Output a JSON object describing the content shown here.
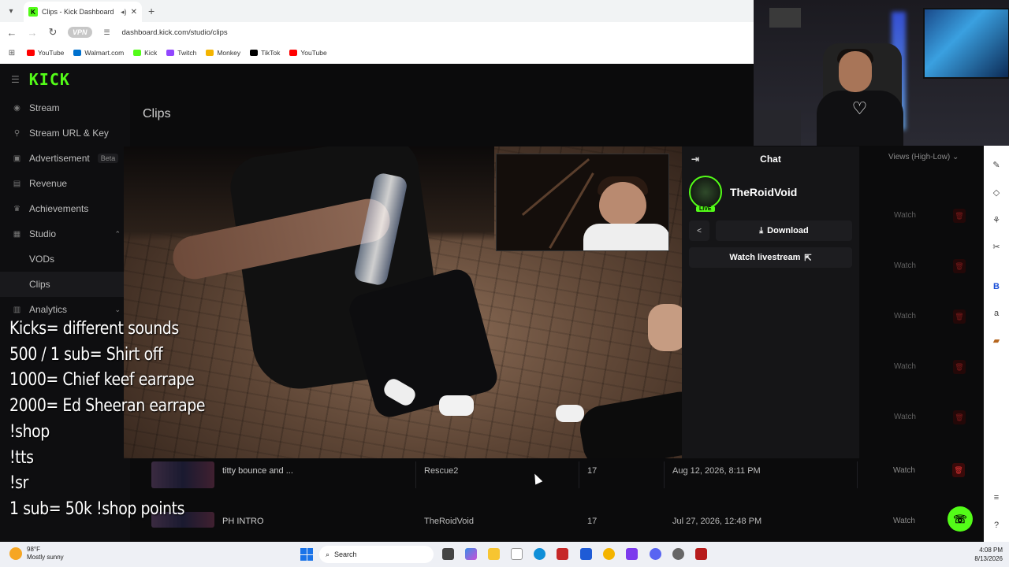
{
  "browser": {
    "tab_title": "Clips - Kick Dashboard",
    "url": "dashboard.kick.com/studio/clips",
    "vpn_label": "VPN",
    "bookmarks": [
      {
        "label": "YouTube",
        "color": "#ff0000"
      },
      {
        "label": "Walmart.com",
        "color": "#0071ce"
      },
      {
        "label": "Kick",
        "color": "#53fc18"
      },
      {
        "label": "Twitch",
        "color": "#9146ff"
      },
      {
        "label": "Monkey",
        "color": "#f4b400"
      },
      {
        "label": "TikTok",
        "color": "#000000"
      },
      {
        "label": "YouTube",
        "color": "#ff0000"
      }
    ]
  },
  "sidebar": {
    "logo": "KICK",
    "items": [
      {
        "label": "Stream",
        "icon": "broadcast-icon"
      },
      {
        "label": "Stream URL & Key",
        "icon": "link-icon"
      },
      {
        "label": "Advertisement",
        "badge": "Beta",
        "icon": "ad-icon"
      },
      {
        "label": "Revenue",
        "icon": "dollar-icon"
      },
      {
        "label": "Achievements",
        "icon": "trophy-icon"
      },
      {
        "label": "Studio",
        "icon": "grid-icon"
      },
      {
        "label": "VODs",
        "icon": ""
      },
      {
        "label": "Clips",
        "icon": ""
      },
      {
        "label": "Analytics",
        "icon": "chart-icon"
      }
    ]
  },
  "main": {
    "title": "Clips",
    "sort_filter": "Views (High-Low)",
    "watch_label": "Watch",
    "rows": [
      {
        "title": "titty bounce and ...",
        "channel": "Rescue2",
        "views": "17",
        "date": "Aug 12, 2026, 8:11 PM"
      },
      {
        "title": "PH INTRO",
        "channel": "TheRoidVoid",
        "views": "17",
        "date": "Jul 27, 2026, 12:48 PM"
      }
    ]
  },
  "chat": {
    "header": "Chat",
    "streamer": "TheRoidVoid",
    "live_badge": "LIVE",
    "download_label": "Download",
    "livestream_label": "Watch livestream"
  },
  "overlay": {
    "lines": [
      "Kicks= different sounds",
      "500 / 1 sub= Shirt off",
      "1000= Chief keef earrape",
      "2000= Ed Sheeran earrape",
      "!shop",
      "!tts",
      "!sr",
      "1 sub= 50k !shop points"
    ]
  },
  "taskbar": {
    "temp": "98°F",
    "weather": "Mostly sunny",
    "search": "Search",
    "time": "4:08 PM",
    "date": "8/13/2026"
  },
  "colors": {
    "kick_green": "#53fc18",
    "danger": "#d33333"
  }
}
